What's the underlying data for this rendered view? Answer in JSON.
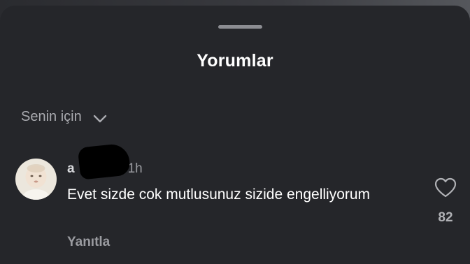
{
  "sheet": {
    "title": "Yorumlar"
  },
  "sort": {
    "label": "Senin için",
    "icon": "chevron-down-icon"
  },
  "comments": [
    {
      "author_visible": "a",
      "time": "1h",
      "text": "Evet sizde cok mutlusunuz sizide engelliyorum",
      "reply_label": "Yanıtla",
      "like_icon": "heart-outline-icon",
      "like_count": "82"
    }
  ],
  "colors": {
    "sheet_bg": "#25262a",
    "primary_text": "#ffffff",
    "secondary_text": "#9a9ba0"
  }
}
